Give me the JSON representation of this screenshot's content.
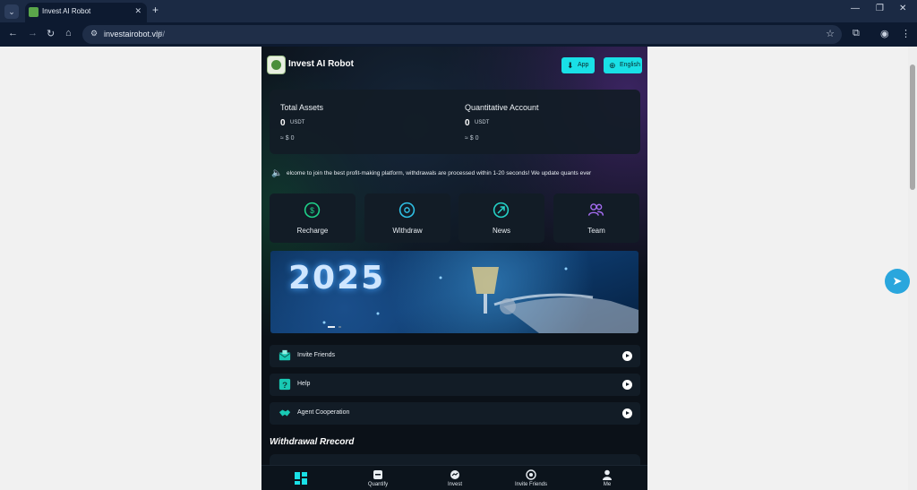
{
  "browser": {
    "tab_title": "Invest AI Robot",
    "url_host": "investairobot.vip",
    "url_path": "/#/"
  },
  "header": {
    "brand": "Invest AI Robot",
    "app_label": "App",
    "language_label": "English"
  },
  "assets": {
    "total": {
      "label": "Total Assets",
      "amount": "0",
      "unit": "USDT",
      "fiat": "≈ $ 0"
    },
    "quant": {
      "label": "Quantitative Account",
      "amount": "0",
      "unit": "USDT",
      "fiat": "≈ $ 0"
    }
  },
  "notice": "elcome to join the best profit-making platform, withdrawals are processed within 1-20 seconds! We update quants ever",
  "quick_actions": [
    {
      "label": "Recharge",
      "icon": "dollar-cycle-icon",
      "color": "#1fd38a"
    },
    {
      "label": "Withdraw",
      "icon": "withdraw-icon",
      "color": "#2fc1e6"
    },
    {
      "label": "News",
      "icon": "news-icon",
      "color": "#25d3c8"
    },
    {
      "label": "Team",
      "icon": "team-icon",
      "color": "#a46cf0"
    }
  ],
  "banner": {
    "text": "2025"
  },
  "menu": [
    {
      "label": "Invite Friends",
      "icon": "envelope-icon"
    },
    {
      "label": "Help",
      "icon": "help-icon"
    },
    {
      "label": "Agent Cooperation",
      "icon": "handshake-icon"
    }
  ],
  "withdrawal_title": "Withdrawal Rrecord",
  "bottom_nav": [
    {
      "label": "",
      "icon": "home-grid-icon"
    },
    {
      "label": "Quantify",
      "icon": "quantify-icon"
    },
    {
      "label": "Invest",
      "icon": "invest-icon"
    },
    {
      "label": "Invite Friends",
      "icon": "invite-icon"
    },
    {
      "label": "Me",
      "icon": "user-icon"
    }
  ],
  "colors": {
    "accent": "#19e0e6",
    "background": "#0b1118",
    "card": "#121c26"
  }
}
